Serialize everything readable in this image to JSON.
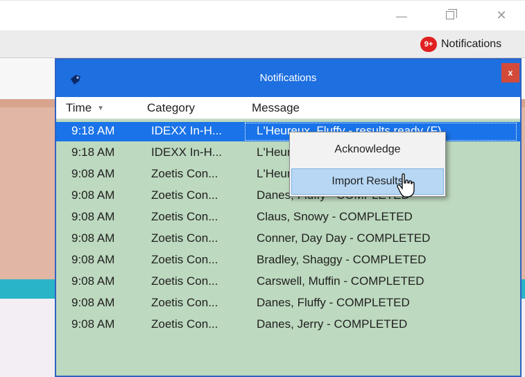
{
  "app": {
    "notifications_link_label": "Notifications",
    "notifications_badge": "9+",
    "colors": {
      "accent": "#1e6fe0",
      "badge": "#e02020",
      "salmon": "#e2b6a4",
      "teal": "#2ab4c8",
      "grid_bg": "#bdd9bf"
    }
  },
  "notifications_window": {
    "title": "Notifications",
    "close_label": "x",
    "columns": {
      "time": "Time",
      "category": "Category",
      "message": "Message"
    },
    "rows": [
      {
        "time": "9:18 AM",
        "category": "IDEXX In-H...",
        "message": "L'Heureux, Fluffy - results ready (F)"
      },
      {
        "time": "9:18 AM",
        "category": "IDEXX In-H...",
        "message": "L'Heureux, Fluffy - results ready (F)"
      },
      {
        "time": "9:08 AM",
        "category": "Zoetis Con...",
        "message": "L'Heureux, Fluffy - COMPLETED"
      },
      {
        "time": "9:08 AM",
        "category": "Zoetis Con...",
        "message": "Danes, Fluffy - COMPLETED"
      },
      {
        "time": "9:08 AM",
        "category": "Zoetis Con...",
        "message": "Claus, Snowy - COMPLETED"
      },
      {
        "time": "9:08 AM",
        "category": "Zoetis Con...",
        "message": "Conner, Day Day - COMPLETED"
      },
      {
        "time": "9:08 AM",
        "category": "Zoetis Con...",
        "message": "Bradley, Shaggy - COMPLETED"
      },
      {
        "time": "9:08 AM",
        "category": "Zoetis Con...",
        "message": "Carswell, Muffin - COMPLETED"
      },
      {
        "time": "9:08 AM",
        "category": "Zoetis Con...",
        "message": "Danes, Fluffy - COMPLETED"
      },
      {
        "time": "9:08 AM",
        "category": "Zoetis Con...",
        "message": "Danes, Jerry - COMPLETED"
      }
    ],
    "selected_row": 0
  },
  "context_menu": {
    "items": [
      {
        "label": "Acknowledge",
        "highlighted": false
      },
      {
        "label": "Import Results",
        "highlighted": true
      }
    ]
  },
  "icons": {
    "window_minimize": "minimize-icon",
    "window_maximize": "maximize-icon",
    "window_close": "close-icon",
    "notifications_window_icon": "tag-icon",
    "cursor": "pointer-cursor-icon"
  }
}
